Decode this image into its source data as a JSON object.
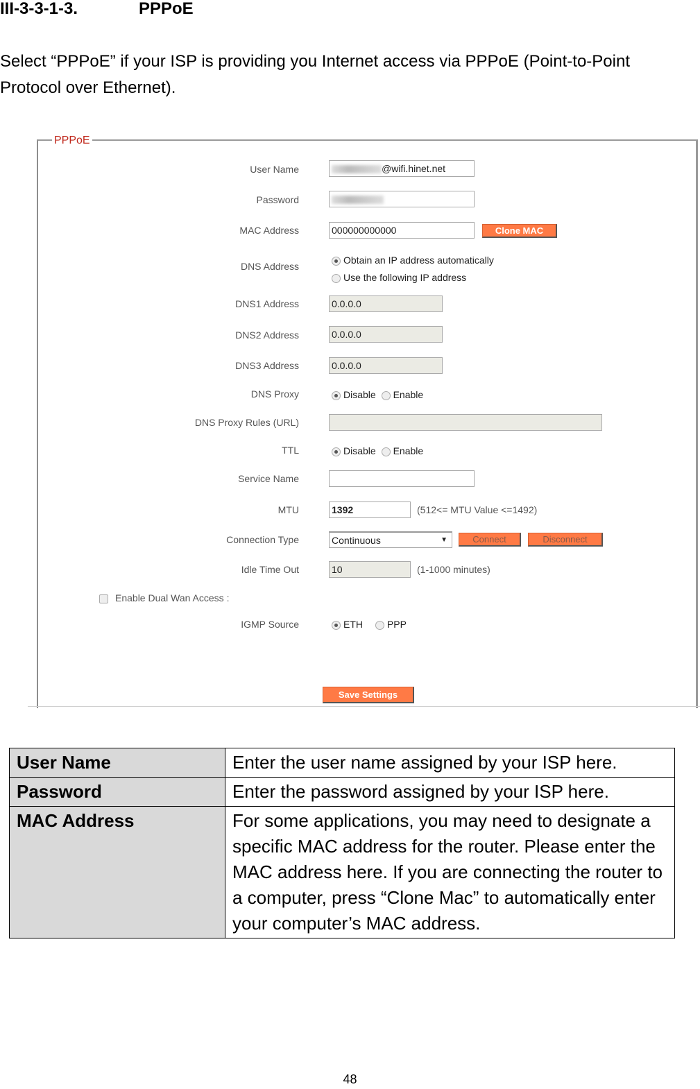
{
  "section": {
    "number": "III-3-3-1-3.",
    "title": "PPPoE"
  },
  "intro": "Select “PPPoE” if your ISP is providing you Internet access via PPPoE (Point-to-Point Protocol over Ethernet).",
  "form": {
    "legend": "PPPoE",
    "user_name": {
      "label": "User Name",
      "value_suffix": "@wifi.hinet.net"
    },
    "password": {
      "label": "Password"
    },
    "mac_address": {
      "label": "MAC Address",
      "value": "000000000000",
      "clone_button": "Clone MAC"
    },
    "dns_address": {
      "label": "DNS  Address",
      "options": [
        "Obtain an IP address automatically",
        "Use the following IP address"
      ],
      "selected": 0
    },
    "dns1": {
      "label": "DNS1  Address",
      "value": "0.0.0.0"
    },
    "dns2": {
      "label": "DNS2  Address",
      "value": "0.0.0.0"
    },
    "dns3": {
      "label": "DNS3  Address",
      "value": "0.0.0.0"
    },
    "dns_proxy": {
      "label": "DNS Proxy",
      "options": [
        "Disable",
        "Enable"
      ],
      "selected": 0
    },
    "dns_proxy_rules": {
      "label": "DNS Proxy Rules (URL)",
      "value": ""
    },
    "ttl": {
      "label": "TTL",
      "options": [
        "Disable",
        "Enable"
      ],
      "selected": 0
    },
    "service_name": {
      "label": "Service Name",
      "value": ""
    },
    "mtu": {
      "label": "MTU",
      "value": "1392",
      "hint": "(512<= MTU  Value <=1492)"
    },
    "connection_type": {
      "label": "Connection Type",
      "value": "Continuous",
      "connect": "Connect",
      "disconnect": "Disconnect"
    },
    "idle_timeout": {
      "label": "Idle Time Out",
      "value": "10",
      "hint": "(1-1000 minutes)"
    },
    "dual_wan": {
      "label": "Enable  Dual Wan Access  :",
      "checked": false
    },
    "igmp_source": {
      "label": "IGMP Source",
      "options": [
        "ETH",
        "PPP"
      ],
      "selected": 0
    },
    "save": "Save Settings"
  },
  "table": [
    {
      "key": "User Name",
      "value": "Enter the user name assigned by your ISP here."
    },
    {
      "key": "Password",
      "value": "Enter the password assigned by your ISP here."
    },
    {
      "key": "MAC Address",
      "value": "For some applications, you may need to designate a specific MAC address for the router. Please enter the MAC address here. If you are connecting the router to a computer, press “Clone Mac” to automatically enter your computer’s MAC address."
    }
  ],
  "page_number": "48"
}
